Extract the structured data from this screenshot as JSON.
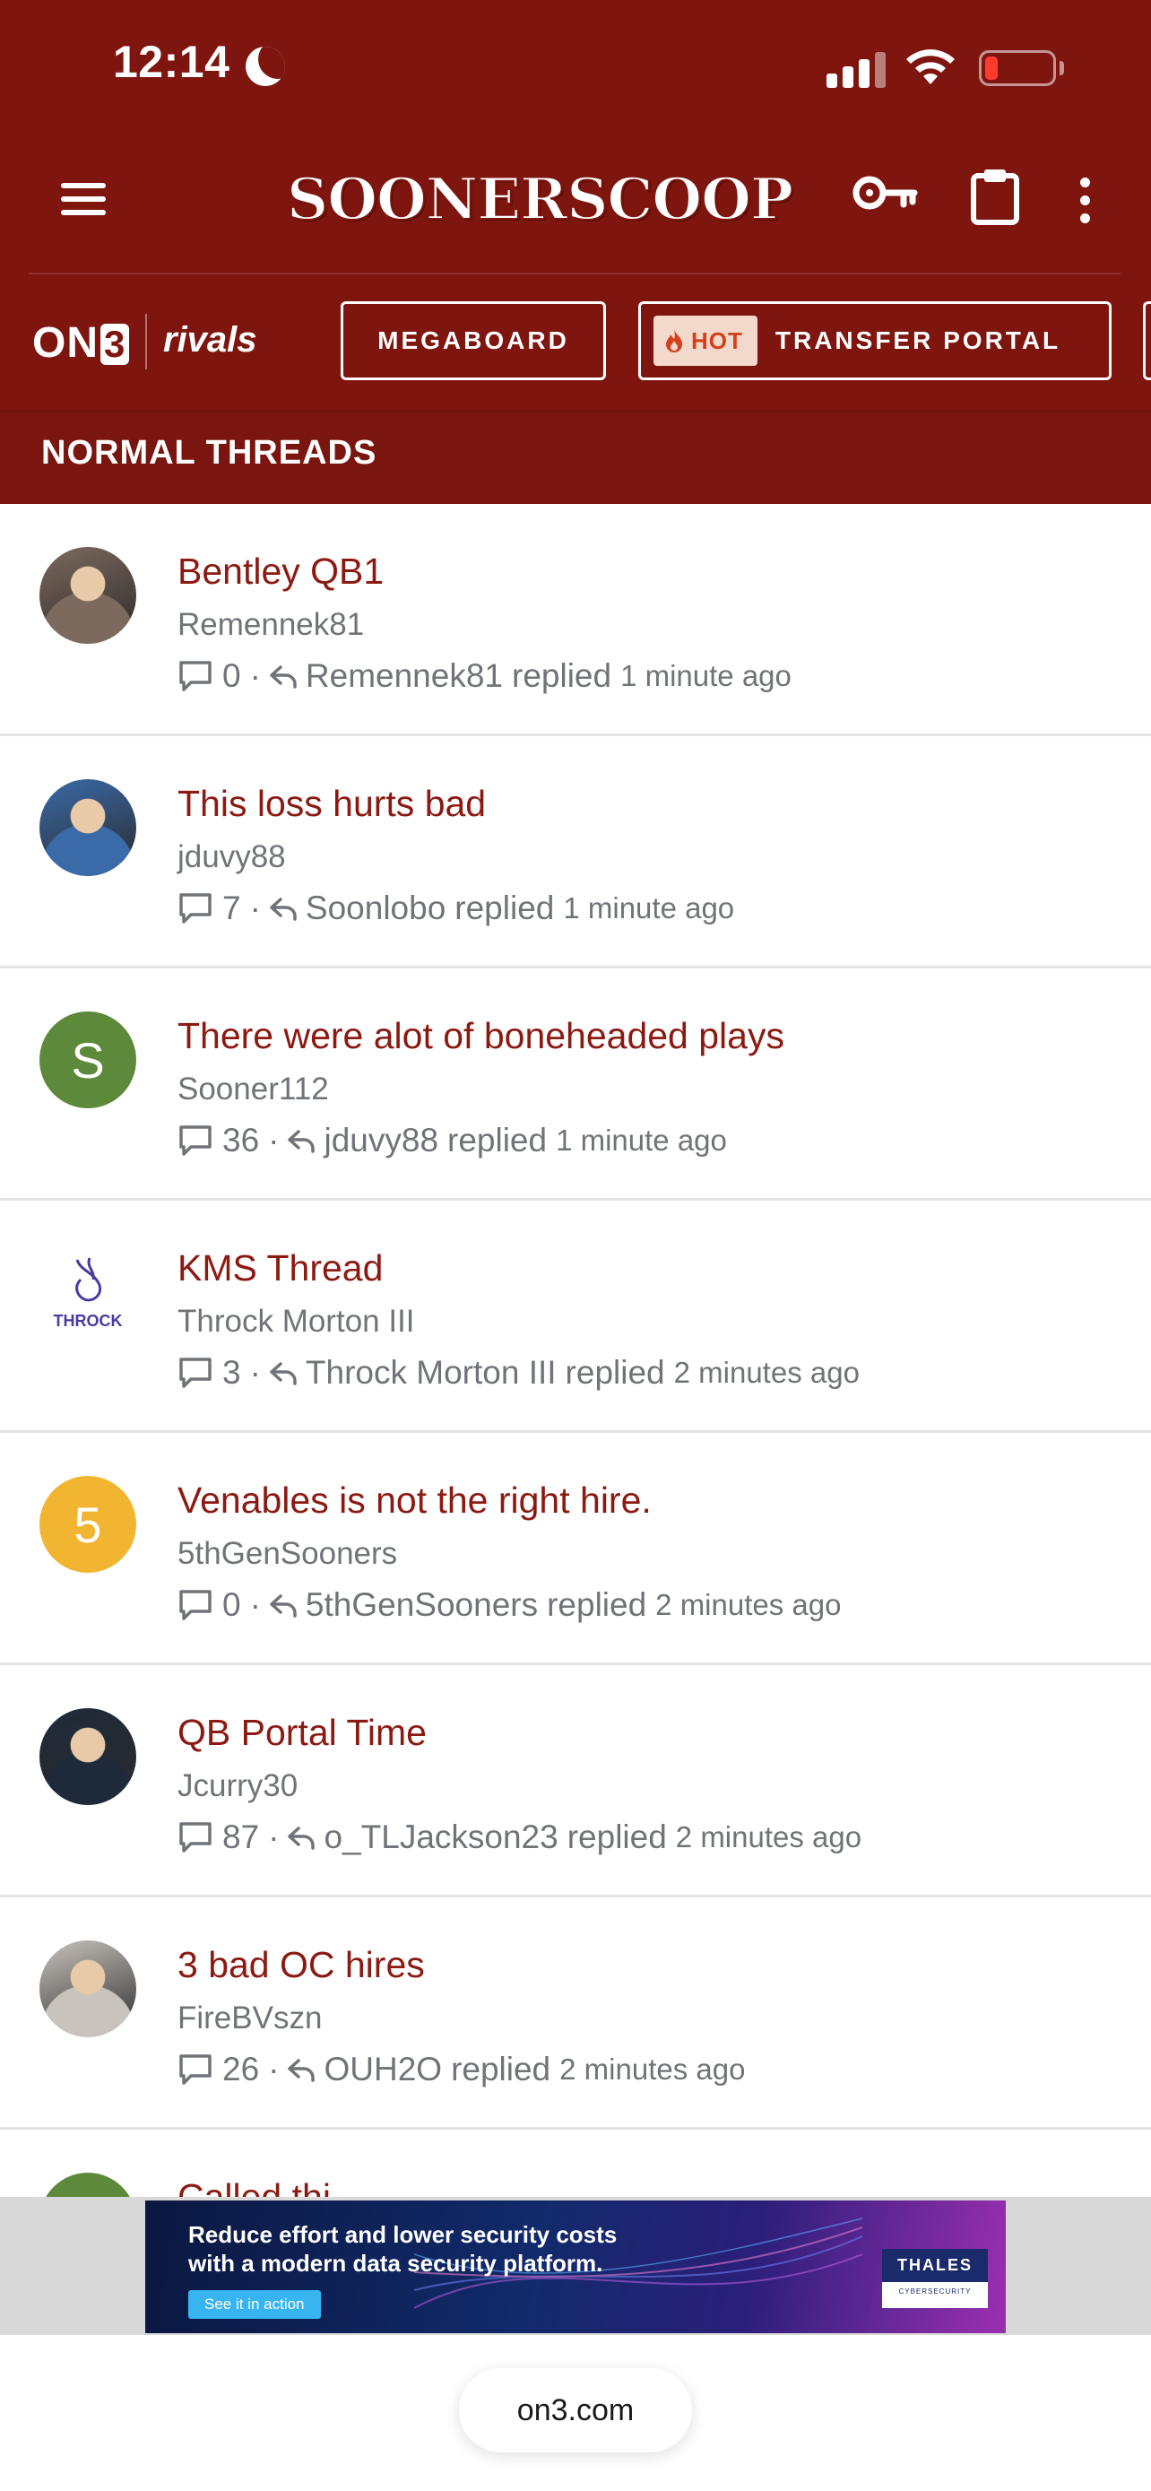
{
  "status_bar": {
    "time": "12:14"
  },
  "app_bar": {
    "logo": "SOONERSCOOP",
    "icons": [
      "hamburger-menu-icon",
      "key-icon",
      "clipboard-icon",
      "more-vertical-icon"
    ]
  },
  "partners": {
    "on3_prefix": "ON",
    "on3_suffix": "3",
    "rivals": "rivals"
  },
  "nav": {
    "megaboard": "MEGABOARD",
    "hot_badge": "HOT",
    "transfer_portal": "TRANSFER PORTAL"
  },
  "section": {
    "title": "NORMAL THREADS"
  },
  "threads": [
    {
      "title": "Bentley QB1",
      "author": "Remennek81",
      "replies": "0",
      "last_replier": "Remennek81",
      "replied_word": "replied",
      "time": "1 minute ago",
      "avatar": {
        "type": "photo",
        "color": "#7d6a5e"
      }
    },
    {
      "title": "This loss hurts bad",
      "author": "jduvy88",
      "replies": "7",
      "last_replier": "Soonlobo",
      "replied_word": "replied",
      "time": "1 minute ago",
      "avatar": {
        "type": "photo",
        "color": "#3a6aa8"
      }
    },
    {
      "title": "There were alot of boneheaded plays",
      "author": "Sooner112",
      "replies": "36",
      "last_replier": "jduvy88",
      "replied_word": "replied",
      "time": "1 minute ago",
      "avatar": {
        "type": "letter",
        "letter": "S",
        "color": "#5d8a3a"
      }
    },
    {
      "title": "KMS Thread",
      "author": "Throck Morton III",
      "replies": "3",
      "last_replier": "Throck Morton III",
      "replied_word": "replied",
      "time": "2 minutes ago",
      "avatar": {
        "type": "logo",
        "label": "THROCK",
        "color": "#4b3aa0"
      }
    },
    {
      "title": "Venables is not the right hire.",
      "author": "5thGenSooners",
      "replies": "0",
      "last_replier": "5thGenSooners",
      "replied_word": "replied",
      "time": "2 minutes ago",
      "avatar": {
        "type": "letter",
        "letter": "5",
        "color": "#f2b531"
      }
    },
    {
      "title": "QB Portal Time",
      "author": "Jcurry30",
      "replies": "87",
      "last_replier": "o_TLJackson23",
      "replied_word": "replied",
      "time": "2 minutes ago",
      "avatar": {
        "type": "photo",
        "color": "#1e2a3a"
      }
    },
    {
      "title": "3 bad OC hires",
      "author": "FireBVszn",
      "replies": "26",
      "last_replier": "OUH2O",
      "replied_word": "replied",
      "time": "2 minutes ago",
      "avatar": {
        "type": "photo",
        "color": "#c9c3bd"
      }
    }
  ],
  "partial_thread": {
    "title": "Called thi",
    "avatar_color": "#5d8a3a"
  },
  "ad": {
    "line1": "Reduce effort and lower security costs",
    "line2": "with a modern data security platform.",
    "cta": "See it in action",
    "brand": "THALES",
    "brand_sub": "CYBERSECURITY"
  },
  "browser": {
    "url": "on3.com"
  },
  "colors": {
    "brand": "#7e160f",
    "link": "#8b1a12",
    "meta": "#707479",
    "hot": "#d3401c"
  }
}
